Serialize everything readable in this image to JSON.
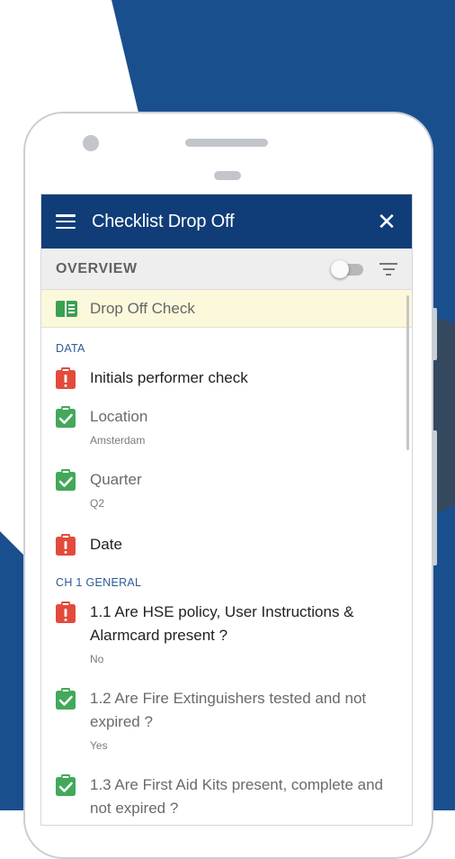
{
  "app_bar": {
    "title": "Checklist Drop Off",
    "menu_icon": "hamburger-menu-icon",
    "close_icon": "close-icon"
  },
  "overview_bar": {
    "label": "OVERVIEW",
    "toggle_on": false,
    "filter_icon": "filter-icon"
  },
  "banner": {
    "label": "Drop Off Check",
    "icon": "checklist-book-icon"
  },
  "sections": [
    {
      "header": "DATA",
      "items": [
        {
          "title": "Initials performer check",
          "status": "incomplete"
        },
        {
          "title": "Location",
          "value": "Amsterdam",
          "status": "complete"
        },
        {
          "title": "Quarter",
          "value": "Q2",
          "status": "complete"
        },
        {
          "title": "Date",
          "status": "incomplete"
        }
      ]
    },
    {
      "header": "CH 1 GENERAL",
      "items": [
        {
          "title": "1.1 Are HSE policy, User Instructions & Alarmcard present ?",
          "value": "No",
          "status": "incomplete"
        },
        {
          "title": "1.2 Are Fire Extinguishers tested and not expired ?",
          "value": "Yes",
          "status": "complete"
        },
        {
          "title": "1.3 Are First Aid Kits present, complete and not expired ?",
          "status": "complete"
        }
      ]
    }
  ],
  "colors": {
    "app_bar": "#103d78",
    "section_header": "#2e5a96",
    "status_incomplete": "#e24b3b",
    "status_complete": "#43a85a",
    "banner_bg": "#fbf8dc",
    "background_blue": "#1a4f8e",
    "background_dark": "#34495e"
  }
}
